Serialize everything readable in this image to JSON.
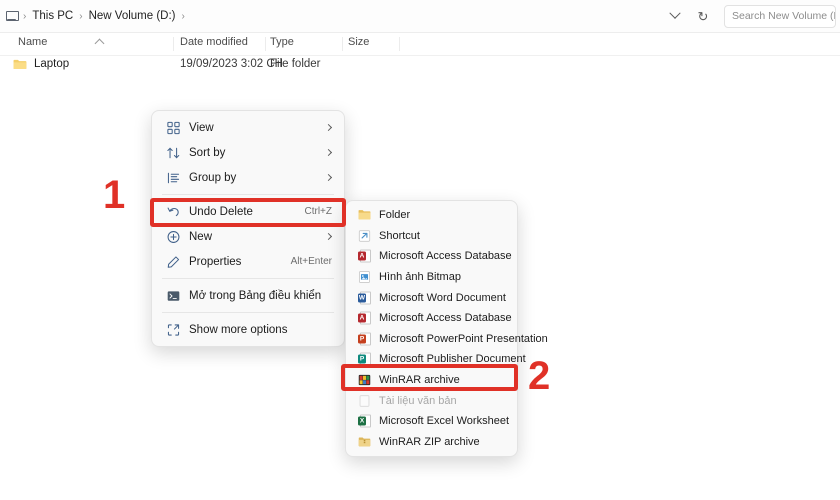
{
  "window": {
    "breadcrumb": [
      "This PC",
      "New Volume (D:)"
    ],
    "pc_icon": "this-pc-icon",
    "recent_dropdown_icon": "chevron-down-icon",
    "refresh_icon": "refresh-icon",
    "search_placeholder": "Search New Volume (D:)"
  },
  "columns": [
    {
      "label": "Name"
    },
    {
      "label": "Date modified"
    },
    {
      "label": "Type"
    },
    {
      "label": "Size"
    }
  ],
  "files": [
    {
      "name": "Laptop",
      "date_modified": "19/09/2023 3:02 CH",
      "type": "File folder",
      "size": "",
      "icon": "folder-icon"
    }
  ],
  "context_menu": {
    "items": [
      {
        "label": "View",
        "icon": "view-grid-icon",
        "accel": "",
        "submenu": true
      },
      {
        "label": "Sort by",
        "icon": "sort-icon",
        "accel": "",
        "submenu": true
      },
      {
        "label": "Group by",
        "icon": "group-by-icon",
        "accel": "",
        "submenu": true
      },
      {
        "label": "Undo Delete",
        "icon": "undo-icon",
        "accel": "Ctrl+Z",
        "submenu": false
      },
      {
        "label": "New",
        "icon": "new-plus-icon",
        "accel": "",
        "submenu": true
      },
      {
        "label": "Properties",
        "icon": "properties-icon",
        "accel": "Alt+Enter",
        "submenu": false
      },
      {
        "label": "Mở trong Bảng điều khiển",
        "icon": "terminal-icon",
        "accel": "",
        "submenu": false
      },
      {
        "label": "Show more options",
        "icon": "more-options-icon",
        "accel": "",
        "submenu": false
      }
    ]
  },
  "new_submenu": {
    "items": [
      {
        "label": "Folder",
        "icon": "folder-icon",
        "color": "#f2c04a",
        "tag": "",
        "disabled": false
      },
      {
        "label": "Shortcut",
        "icon": "shortcut-icon",
        "color": "#4a8fc7",
        "tag": "",
        "disabled": false
      },
      {
        "label": "Microsoft Access Database",
        "icon": "access-icon",
        "color": "#b5292f",
        "tag": "A",
        "disabled": false
      },
      {
        "label": "Hình ảnh Bitmap",
        "icon": "bitmap-image-icon",
        "color": "#3f8fd0",
        "tag": "",
        "disabled": false
      },
      {
        "label": "Microsoft Word Document",
        "icon": "word-icon",
        "color": "#2a5b9b",
        "tag": "W",
        "disabled": false
      },
      {
        "label": "Microsoft Access Database",
        "icon": "access-icon",
        "color": "#b5292f",
        "tag": "A",
        "disabled": false
      },
      {
        "label": "Microsoft PowerPoint Presentation",
        "icon": "powerpoint-icon",
        "color": "#c5401f",
        "tag": "P",
        "disabled": false
      },
      {
        "label": "Microsoft Publisher Document",
        "icon": "publisher-icon",
        "color": "#0f8a7e",
        "tag": "P",
        "disabled": false
      },
      {
        "label": "WinRAR archive",
        "icon": "winrar-icon",
        "color": "#8a2b8a",
        "tag": "",
        "disabled": false
      },
      {
        "label": "Tài liệu văn bản",
        "icon": "text-document-icon",
        "color": "#cfcfcf",
        "tag": "",
        "disabled": true
      },
      {
        "label": "Microsoft Excel Worksheet",
        "icon": "excel-icon",
        "color": "#1d7044",
        "tag": "X",
        "disabled": false
      },
      {
        "label": "WinRAR ZIP archive",
        "icon": "winrar-zip-icon",
        "color": "#e0c060",
        "tag": "",
        "disabled": false
      }
    ]
  },
  "annotations": {
    "accent_color": "#e03127",
    "step_one": "1",
    "step_two": "2",
    "highlight_one_target": "New",
    "highlight_two_target": "WinRAR archive"
  }
}
